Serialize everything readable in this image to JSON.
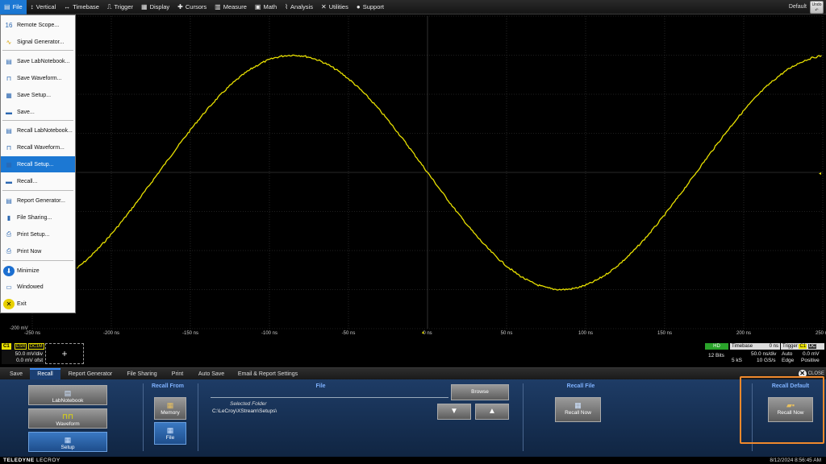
{
  "menubar": {
    "items": [
      {
        "label": "File",
        "icon": "file-icon",
        "glyph": "▤"
      },
      {
        "label": "Vertical",
        "icon": "vertical-icon",
        "glyph": "↕"
      },
      {
        "label": "Timebase",
        "icon": "timebase-icon",
        "glyph": "↔"
      },
      {
        "label": "Trigger",
        "icon": "trigger-icon",
        "glyph": "⎍"
      },
      {
        "label": "Display",
        "icon": "display-icon",
        "glyph": "▦"
      },
      {
        "label": "Cursors",
        "icon": "cursors-icon",
        "glyph": "✚"
      },
      {
        "label": "Measure",
        "icon": "measure-icon",
        "glyph": "▥"
      },
      {
        "label": "Math",
        "icon": "math-icon",
        "glyph": "▣"
      },
      {
        "label": "Analysis",
        "icon": "analysis-icon",
        "glyph": "⌇"
      },
      {
        "label": "Utilities",
        "icon": "utilities-icon",
        "glyph": "✕"
      },
      {
        "label": "Support",
        "icon": "support-icon",
        "glyph": "●"
      }
    ],
    "default_label": "Default",
    "undo_label": "Undo"
  },
  "file_menu": {
    "items": [
      {
        "label": "Remote Scope...",
        "icon": "remote-scope-icon",
        "glyph": "16"
      },
      {
        "label": "Signal Generator...",
        "icon": "signal-generator-icon",
        "glyph": "∿"
      },
      {
        "label": "Save LabNotebook...",
        "icon": "save-labnotebook-icon",
        "glyph": "▤"
      },
      {
        "label": "Save Waveform...",
        "icon": "save-waveform-icon",
        "glyph": "⊓"
      },
      {
        "label": "Save Setup...",
        "icon": "save-setup-icon",
        "glyph": "▦"
      },
      {
        "label": "Save...",
        "icon": "save-icon",
        "glyph": "▬"
      },
      {
        "label": "Recall LabNotebook...",
        "icon": "recall-labnotebook-icon",
        "glyph": "▤"
      },
      {
        "label": "Recall Waveform...",
        "icon": "recall-waveform-icon",
        "glyph": "⊓"
      },
      {
        "label": "Recall Setup...",
        "icon": "recall-setup-icon",
        "glyph": "▦"
      },
      {
        "label": "Recall...",
        "icon": "recall-icon",
        "glyph": "▬"
      },
      {
        "label": "Report Generator...",
        "icon": "report-generator-icon",
        "glyph": "▤"
      },
      {
        "label": "File Sharing...",
        "icon": "file-sharing-icon",
        "glyph": "▮"
      },
      {
        "label": "Print Setup...",
        "icon": "print-setup-icon",
        "glyph": "⎙"
      },
      {
        "label": "Print Now",
        "icon": "print-now-icon",
        "glyph": "⎙"
      },
      {
        "label": "Minimize",
        "icon": "minimize-icon",
        "glyph": "⬇"
      },
      {
        "label": "Windowed",
        "icon": "windowed-icon",
        "glyph": "▭"
      },
      {
        "label": "Exit",
        "icon": "exit-icon",
        "glyph": "✕"
      }
    ],
    "selected": "Recall Setup..."
  },
  "grid": {
    "y_min_label": "-200 mV",
    "x_ticks": [
      "-250 ns",
      "-200 ns",
      "-150 ns",
      "-100 ns",
      "-50 ns",
      "0 ns",
      "50 ns",
      "100 ns",
      "150 ns",
      "200 ns",
      "250 ns"
    ]
  },
  "trace": {
    "color": "#e8e000",
    "amplitude_div": 3.0,
    "phase_deg": 0,
    "period_ns": 340,
    "center_offset_div": 0
  },
  "channel": {
    "tag": "C1",
    "flags": [
      "ESR",
      "DC1M"
    ],
    "volts_div": "50.0 mV/div",
    "offset": "0.0 mV ofst",
    "add_label": "+"
  },
  "status": {
    "hd_badge": "HD",
    "bits": "12 Bits",
    "timebase_label": "Timebase",
    "timebase_delay": "0 ns",
    "timebase_div": "50.0 ns/div",
    "samples": "5 kS",
    "sample_rate": "10 GS/s",
    "trigger_label": "Trigger",
    "trigger_tags": [
      "C1",
      "DC"
    ],
    "trigger_mode": "Auto",
    "trigger_level": "0.0 mV",
    "trigger_type": "Edge",
    "trigger_slope": "Positive"
  },
  "tabs": {
    "items": [
      "Save",
      "Recall",
      "Report Generator",
      "File Sharing",
      "Print",
      "Auto Save",
      "Email & Report Settings"
    ],
    "active": "Recall",
    "close_label": "CLOSE"
  },
  "dialog": {
    "type_buttons": [
      {
        "label": "LabNotebook",
        "icon": "labnotebook-icon",
        "glyph": "▤"
      },
      {
        "label": "Waveform",
        "icon": "waveform-icon",
        "glyph": "⊓⊓"
      },
      {
        "label": "Setup",
        "icon": "setup-icon",
        "glyph": "▦"
      }
    ],
    "recall_from_title": "Recall From",
    "recall_from_buttons": [
      {
        "label": "Memory",
        "icon": "memory-icon",
        "glyph": "▦"
      },
      {
        "label": "File",
        "icon": "file-source-icon",
        "glyph": "▦"
      }
    ],
    "file_title": "File",
    "browse_label": "Browse",
    "selected_folder_label": "Selected Folder",
    "folder_path": "C:\\LeCroy\\XStream\\Setups\\",
    "recall_file_title": "Recall File",
    "recall_file_button": "Recall Now",
    "recall_default_title": "Recall Default",
    "recall_default_button": "Recall Now"
  },
  "footer": {
    "brand_bold": "TELEDYNE",
    "brand_light": "LECROY",
    "datetime": "8/12/2024 8:56:45 AM"
  }
}
